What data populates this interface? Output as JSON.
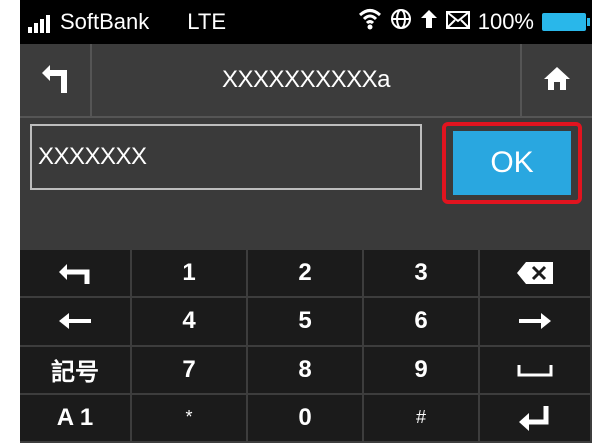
{
  "status_bar": {
    "carrier": "SoftBank",
    "network": "LTE",
    "battery": "100%",
    "icons": [
      "signal-icon",
      "wifi-icon",
      "globe-icon",
      "upload-icon",
      "mail-icon",
      "battery-icon"
    ]
  },
  "header": {
    "title": "XXXXXXXXXXa",
    "back_icon": "back-icon",
    "home_icon": "home-icon"
  },
  "input": {
    "value": "XXXXXXX",
    "ok_label": "OK"
  },
  "keypad": {
    "rows": [
      [
        {
          "label": "",
          "icon": "undo-icon"
        },
        {
          "label": "1"
        },
        {
          "label": "2"
        },
        {
          "label": "3"
        },
        {
          "label": "",
          "icon": "backspace-icon"
        }
      ],
      [
        {
          "label": "",
          "icon": "arrow-left-icon"
        },
        {
          "label": "4"
        },
        {
          "label": "5"
        },
        {
          "label": "6"
        },
        {
          "label": "",
          "icon": "arrow-right-icon"
        }
      ],
      [
        {
          "label": "記号"
        },
        {
          "label": "7"
        },
        {
          "label": "8"
        },
        {
          "label": "9"
        },
        {
          "label": "",
          "icon": "space-icon"
        }
      ],
      [
        {
          "label": "A 1"
        },
        {
          "label": "*"
        },
        {
          "label": "0"
        },
        {
          "label": "#"
        },
        {
          "label": "",
          "icon": "enter-icon"
        }
      ]
    ]
  },
  "colors": {
    "accent_blue": "#29a7e0",
    "highlight_red": "#e1141f",
    "battery": "#29b7ea"
  }
}
